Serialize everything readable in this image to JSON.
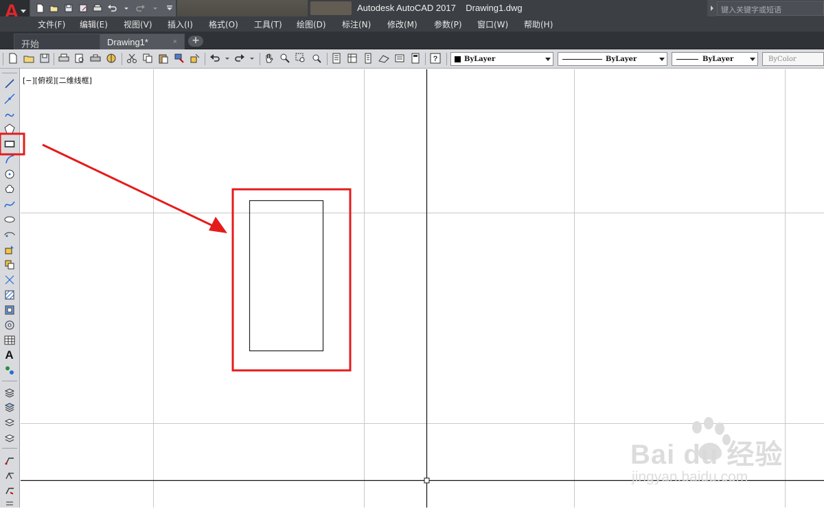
{
  "app": {
    "logo_letter": "A",
    "title": "Autodesk AutoCAD 2017    Drawing1.dwg",
    "search_placeholder": "键入关键字或短语"
  },
  "menu": [
    "文件(F)",
    "编辑(E)",
    "视图(V)",
    "插入(I)",
    "格式(O)",
    "工具(T)",
    "绘图(D)",
    "标注(N)",
    "修改(M)",
    "参数(P)",
    "窗口(W)",
    "帮助(H)"
  ],
  "tabs": [
    {
      "label": "开始",
      "active": false
    },
    {
      "label": "Drawing1*",
      "active": true,
      "close": "×"
    }
  ],
  "tab_add": "+",
  "properties": {
    "color": "ByLayer",
    "linetype": "ByLayer",
    "lineweight": "ByLayer",
    "plotstyle": "ByColor"
  },
  "left_toolbar_text_icon": "A",
  "canvas": {
    "viewport_label": "[−][俯视][二维线框]"
  },
  "annotation": {
    "highlight_color": "#e51b1b",
    "target": "rectangle-tool"
  },
  "watermark": {
    "brand": "Bai  du 经验",
    "url": "jingyan.baidu.com"
  },
  "colors": {
    "chrome_dark": "#3c3f44",
    "toolbar_gray": "#d9dade",
    "autocad_red": "#e0262b"
  }
}
